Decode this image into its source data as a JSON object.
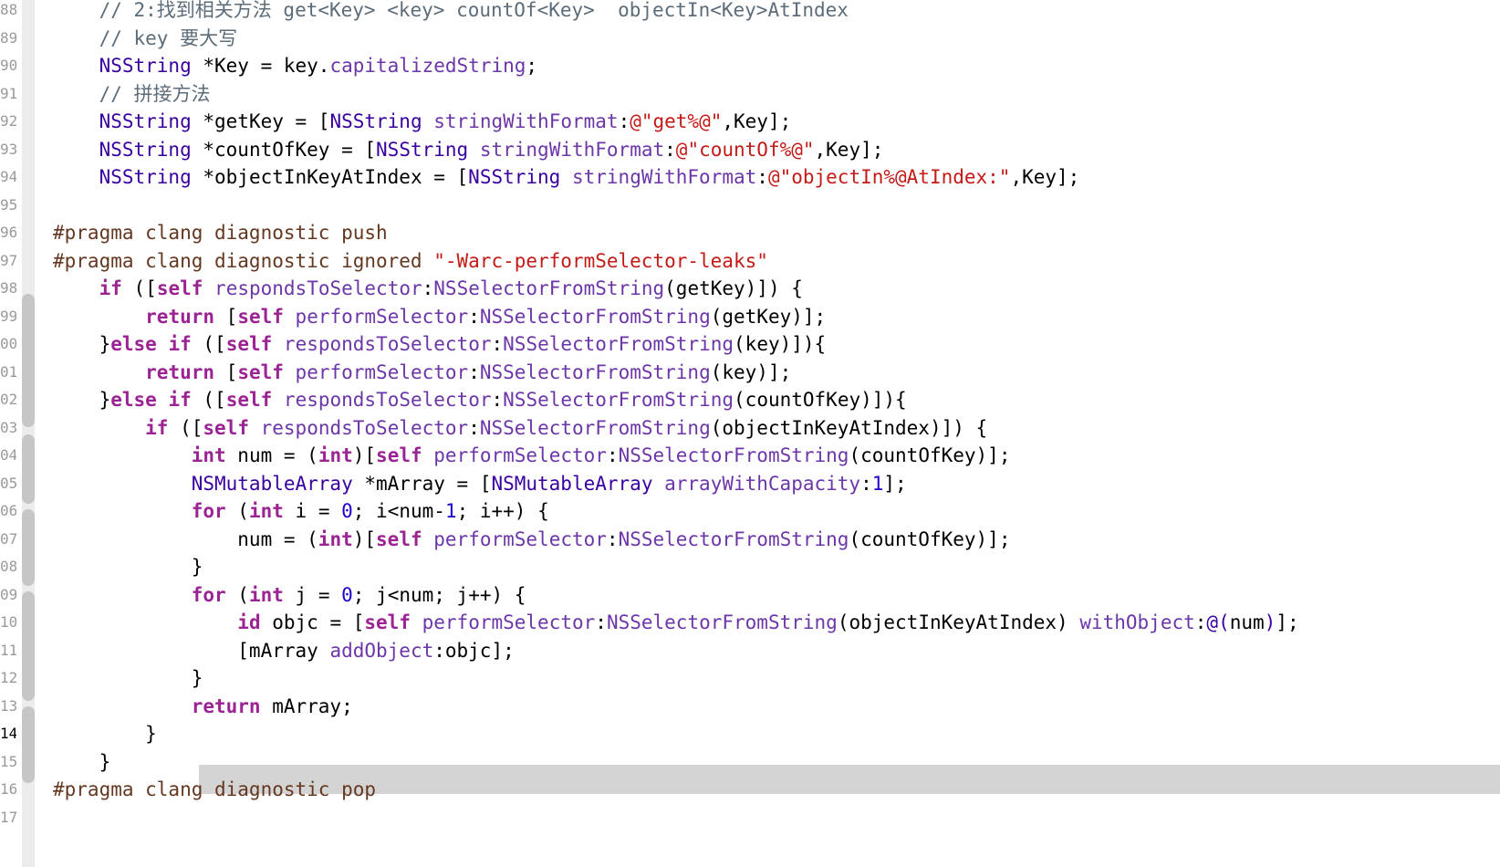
{
  "editor": {
    "gutter": {
      "line_numbers": [
        "88",
        "89",
        "90",
        "91",
        "92",
        "93",
        "94",
        "95",
        "96",
        "97",
        "98",
        "99",
        "00",
        "01",
        "02",
        "03",
        "04",
        "05",
        "06",
        "07",
        "08",
        "09",
        "10",
        "11",
        "12",
        "13",
        "14",
        "15",
        "16",
        "17"
      ],
      "current_line": "14"
    },
    "colors": {
      "keyword": "#9b2393",
      "type": "#0b4f79",
      "class": "#3900a0",
      "method": "#6c36a9",
      "string": "#c41a16",
      "number": "#1c00cf",
      "comment": "#5d6c79",
      "preprocessor": "#643820",
      "current_line_highlight": "#d4d4d4"
    },
    "lines": [
      [
        {
          "t": "comment",
          "s": "    // 2:找到相关方法 get<Key> <key> countOf<Key>  objectIn<Key>AtIndex"
        }
      ],
      [
        {
          "t": "comment",
          "s": "    // key 要大写"
        }
      ],
      [
        {
          "t": "plain",
          "s": "    "
        },
        {
          "t": "class",
          "s": "NSString"
        },
        {
          "t": "plain",
          "s": " *Key = key."
        },
        {
          "t": "method",
          "s": "capitalizedString"
        },
        {
          "t": "plain",
          "s": ";"
        }
      ],
      [
        {
          "t": "comment",
          "s": "    // 拼接方法"
        }
      ],
      [
        {
          "t": "plain",
          "s": "    "
        },
        {
          "t": "class",
          "s": "NSString"
        },
        {
          "t": "plain",
          "s": " *getKey = ["
        },
        {
          "t": "class",
          "s": "NSString"
        },
        {
          "t": "plain",
          "s": " "
        },
        {
          "t": "method",
          "s": "stringWithFormat"
        },
        {
          "t": "plain",
          "s": ":"
        },
        {
          "t": "string",
          "s": "@\"get%@\""
        },
        {
          "t": "plain",
          "s": ",Key];"
        }
      ],
      [
        {
          "t": "plain",
          "s": "    "
        },
        {
          "t": "class",
          "s": "NSString"
        },
        {
          "t": "plain",
          "s": " *countOfKey = ["
        },
        {
          "t": "class",
          "s": "NSString"
        },
        {
          "t": "plain",
          "s": " "
        },
        {
          "t": "method",
          "s": "stringWithFormat"
        },
        {
          "t": "plain",
          "s": ":"
        },
        {
          "t": "string",
          "s": "@\"countOf%@\""
        },
        {
          "t": "plain",
          "s": ",Key];"
        }
      ],
      [
        {
          "t": "plain",
          "s": "    "
        },
        {
          "t": "class",
          "s": "NSString"
        },
        {
          "t": "plain",
          "s": " *objectInKeyAtIndex = ["
        },
        {
          "t": "class",
          "s": "NSString"
        },
        {
          "t": "plain",
          "s": " "
        },
        {
          "t": "method",
          "s": "stringWithFormat"
        },
        {
          "t": "plain",
          "s": ":"
        },
        {
          "t": "string",
          "s": "@\"objectIn%@AtIndex:\""
        },
        {
          "t": "plain",
          "s": ",Key];"
        }
      ],
      [
        {
          "t": "plain",
          "s": ""
        }
      ],
      [
        {
          "t": "preproc",
          "s": "#pragma clang diagnostic push"
        }
      ],
      [
        {
          "t": "preproc",
          "s": "#pragma clang diagnostic ignored "
        },
        {
          "t": "string",
          "s": "\"-Warc-performSelector-leaks\""
        }
      ],
      [
        {
          "t": "plain",
          "s": "    "
        },
        {
          "t": "keyword",
          "s": "if"
        },
        {
          "t": "plain",
          "s": " (["
        },
        {
          "t": "keyword",
          "s": "self"
        },
        {
          "t": "plain",
          "s": " "
        },
        {
          "t": "method",
          "s": "respondsToSelector"
        },
        {
          "t": "plain",
          "s": ":"
        },
        {
          "t": "method",
          "s": "NSSelectorFromString"
        },
        {
          "t": "plain",
          "s": "(getKey)]) {"
        }
      ],
      [
        {
          "t": "plain",
          "s": "        "
        },
        {
          "t": "keyword",
          "s": "return"
        },
        {
          "t": "plain",
          "s": " ["
        },
        {
          "t": "keyword",
          "s": "self"
        },
        {
          "t": "plain",
          "s": " "
        },
        {
          "t": "method",
          "s": "performSelector"
        },
        {
          "t": "plain",
          "s": ":"
        },
        {
          "t": "method",
          "s": "NSSelectorFromString"
        },
        {
          "t": "plain",
          "s": "(getKey)];"
        }
      ],
      [
        {
          "t": "plain",
          "s": "    }"
        },
        {
          "t": "keyword",
          "s": "else"
        },
        {
          "t": "plain",
          "s": " "
        },
        {
          "t": "keyword",
          "s": "if"
        },
        {
          "t": "plain",
          "s": " (["
        },
        {
          "t": "keyword",
          "s": "self"
        },
        {
          "t": "plain",
          "s": " "
        },
        {
          "t": "method",
          "s": "respondsToSelector"
        },
        {
          "t": "plain",
          "s": ":"
        },
        {
          "t": "method",
          "s": "NSSelectorFromString"
        },
        {
          "t": "plain",
          "s": "(key)]){"
        }
      ],
      [
        {
          "t": "plain",
          "s": "        "
        },
        {
          "t": "keyword",
          "s": "return"
        },
        {
          "t": "plain",
          "s": " ["
        },
        {
          "t": "keyword",
          "s": "self"
        },
        {
          "t": "plain",
          "s": " "
        },
        {
          "t": "method",
          "s": "performSelector"
        },
        {
          "t": "plain",
          "s": ":"
        },
        {
          "t": "method",
          "s": "NSSelectorFromString"
        },
        {
          "t": "plain",
          "s": "(key)];"
        }
      ],
      [
        {
          "t": "plain",
          "s": "    }"
        },
        {
          "t": "keyword",
          "s": "else"
        },
        {
          "t": "plain",
          "s": " "
        },
        {
          "t": "keyword",
          "s": "if"
        },
        {
          "t": "plain",
          "s": " (["
        },
        {
          "t": "keyword",
          "s": "self"
        },
        {
          "t": "plain",
          "s": " "
        },
        {
          "t": "method",
          "s": "respondsToSelector"
        },
        {
          "t": "plain",
          "s": ":"
        },
        {
          "t": "method",
          "s": "NSSelectorFromString"
        },
        {
          "t": "plain",
          "s": "(countOfKey)]){"
        }
      ],
      [
        {
          "t": "plain",
          "s": "        "
        },
        {
          "t": "keyword",
          "s": "if"
        },
        {
          "t": "plain",
          "s": " (["
        },
        {
          "t": "keyword",
          "s": "self"
        },
        {
          "t": "plain",
          "s": " "
        },
        {
          "t": "method",
          "s": "respondsToSelector"
        },
        {
          "t": "plain",
          "s": ":"
        },
        {
          "t": "method",
          "s": "NSSelectorFromString"
        },
        {
          "t": "plain",
          "s": "(objectInKeyAtIndex)]) {"
        }
      ],
      [
        {
          "t": "plain",
          "s": "            "
        },
        {
          "t": "keyword",
          "s": "int"
        },
        {
          "t": "plain",
          "s": " num = ("
        },
        {
          "t": "keyword",
          "s": "int"
        },
        {
          "t": "plain",
          "s": ")["
        },
        {
          "t": "keyword",
          "s": "self"
        },
        {
          "t": "plain",
          "s": " "
        },
        {
          "t": "method",
          "s": "performSelector"
        },
        {
          "t": "plain",
          "s": ":"
        },
        {
          "t": "method",
          "s": "NSSelectorFromString"
        },
        {
          "t": "plain",
          "s": "(countOfKey)];"
        }
      ],
      [
        {
          "t": "plain",
          "s": "            "
        },
        {
          "t": "class",
          "s": "NSMutableArray"
        },
        {
          "t": "plain",
          "s": " *mArray = ["
        },
        {
          "t": "class",
          "s": "NSMutableArray"
        },
        {
          "t": "plain",
          "s": " "
        },
        {
          "t": "method",
          "s": "arrayWithCapacity"
        },
        {
          "t": "plain",
          "s": ":"
        },
        {
          "t": "number",
          "s": "1"
        },
        {
          "t": "plain",
          "s": "];"
        }
      ],
      [
        {
          "t": "plain",
          "s": "            "
        },
        {
          "t": "keyword",
          "s": "for"
        },
        {
          "t": "plain",
          "s": " ("
        },
        {
          "t": "keyword",
          "s": "int"
        },
        {
          "t": "plain",
          "s": " i = "
        },
        {
          "t": "number",
          "s": "0"
        },
        {
          "t": "plain",
          "s": "; i<num-"
        },
        {
          "t": "number",
          "s": "1"
        },
        {
          "t": "plain",
          "s": "; i++) {"
        }
      ],
      [
        {
          "t": "plain",
          "s": "                num = ("
        },
        {
          "t": "keyword",
          "s": "int"
        },
        {
          "t": "plain",
          "s": ")["
        },
        {
          "t": "keyword",
          "s": "self"
        },
        {
          "t": "plain",
          "s": " "
        },
        {
          "t": "method",
          "s": "performSelector"
        },
        {
          "t": "plain",
          "s": ":"
        },
        {
          "t": "method",
          "s": "NSSelectorFromString"
        },
        {
          "t": "plain",
          "s": "(countOfKey)];"
        }
      ],
      [
        {
          "t": "plain",
          "s": "            }"
        }
      ],
      [
        {
          "t": "plain",
          "s": "            "
        },
        {
          "t": "keyword",
          "s": "for"
        },
        {
          "t": "plain",
          "s": " ("
        },
        {
          "t": "keyword",
          "s": "int"
        },
        {
          "t": "plain",
          "s": " j = "
        },
        {
          "t": "number",
          "s": "0"
        },
        {
          "t": "plain",
          "s": "; j<num; j++) {"
        }
      ],
      [
        {
          "t": "plain",
          "s": "                "
        },
        {
          "t": "keyword",
          "s": "id"
        },
        {
          "t": "plain",
          "s": " objc = ["
        },
        {
          "t": "keyword",
          "s": "self"
        },
        {
          "t": "plain",
          "s": " "
        },
        {
          "t": "method",
          "s": "performSelector"
        },
        {
          "t": "plain",
          "s": ":"
        },
        {
          "t": "method",
          "s": "NSSelectorFromString"
        },
        {
          "t": "plain",
          "s": "(objectInKeyAtIndex) "
        },
        {
          "t": "method",
          "s": "withObject"
        },
        {
          "t": "plain",
          "s": ":"
        },
        {
          "t": "class",
          "s": "@("
        },
        {
          "t": "plain",
          "s": "num"
        },
        {
          "t": "class",
          "s": ")"
        },
        {
          "t": "plain",
          "s": "];"
        }
      ],
      [
        {
          "t": "plain",
          "s": "                [mArray "
        },
        {
          "t": "method",
          "s": "addObject"
        },
        {
          "t": "plain",
          "s": ":objc];"
        }
      ],
      [
        {
          "t": "plain",
          "s": "            }"
        }
      ],
      [
        {
          "t": "plain",
          "s": "            "
        },
        {
          "t": "keyword",
          "s": "return"
        },
        {
          "t": "plain",
          "s": " mArray;"
        }
      ],
      [
        {
          "t": "plain",
          "s": "        }"
        }
      ],
      [
        {
          "t": "plain",
          "s": "    }"
        }
      ],
      [
        {
          "t": "preproc",
          "s": "#pragma clang diagnostic pop"
        }
      ],
      [
        {
          "t": "plain",
          "s": ""
        }
      ]
    ]
  }
}
